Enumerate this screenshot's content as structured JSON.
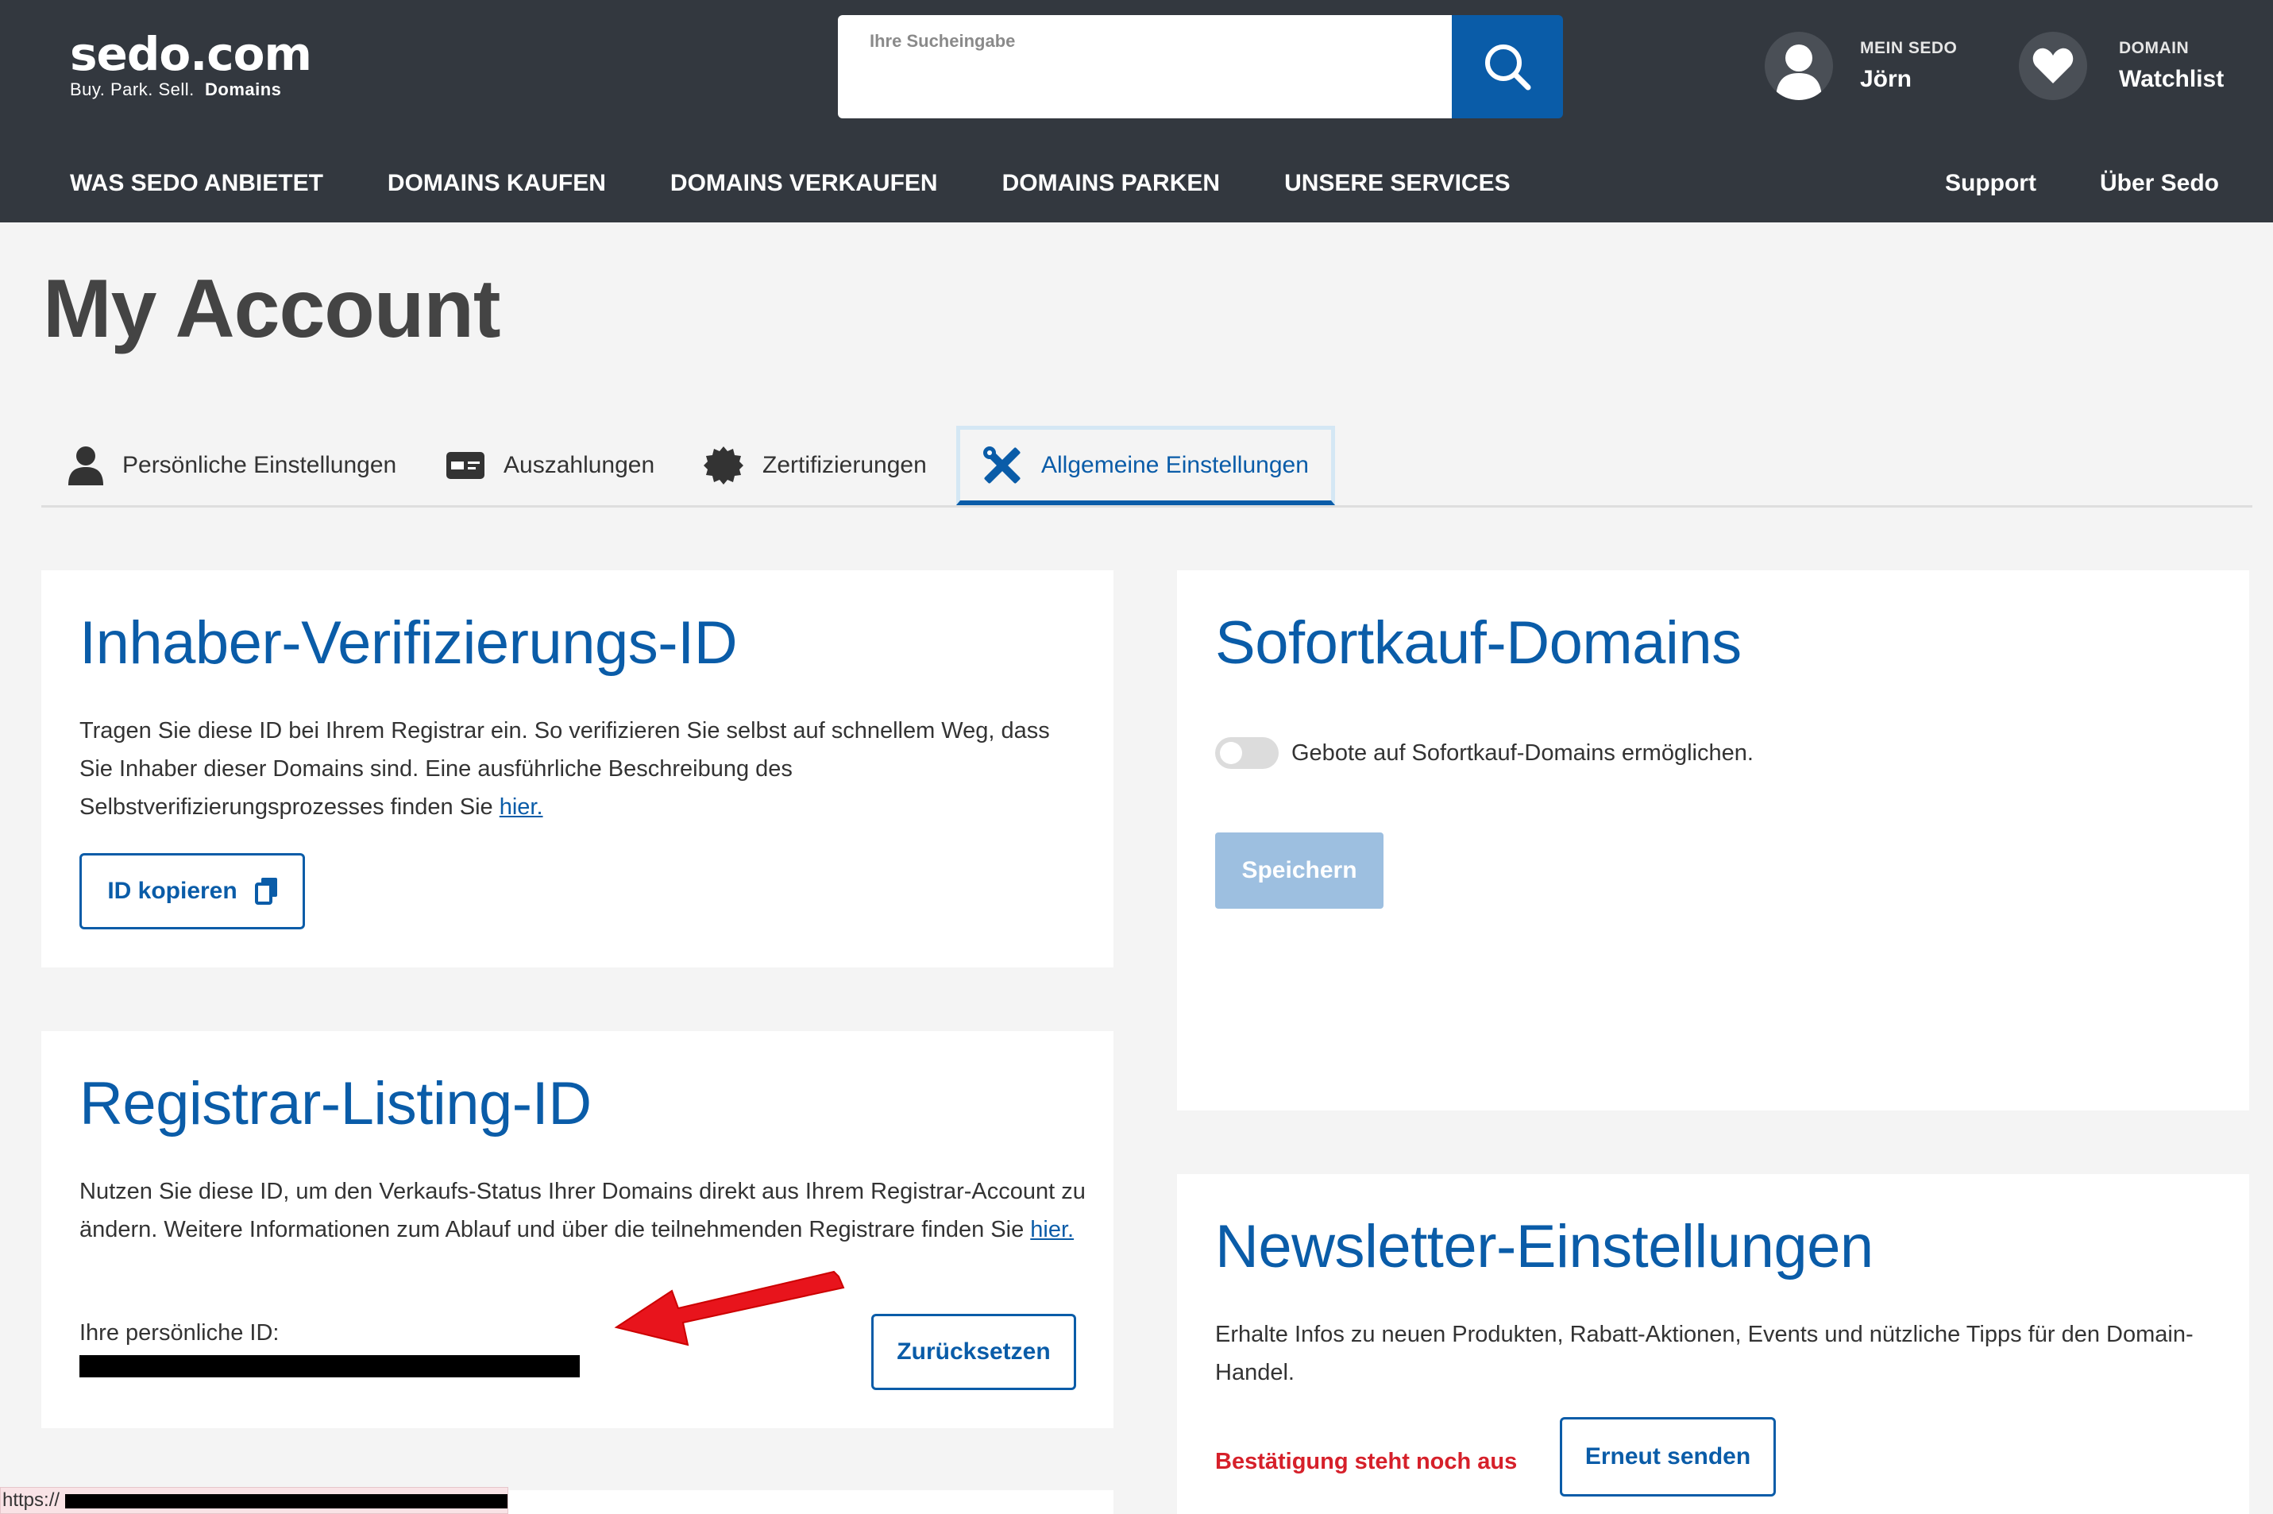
{
  "header": {
    "logo_main": "sedo.com",
    "logo_sub_plain": "Buy.  Park.  Sell.",
    "logo_sub_bold": "Domains",
    "search_placeholder": "Ihre Sucheingabe",
    "account": {
      "small": "MEIN SEDO",
      "big": "Jörn"
    },
    "watchlist": {
      "small": "DOMAIN",
      "big": "Watchlist"
    },
    "nav": [
      "WAS SEDO ANBIETET",
      "DOMAINS KAUFEN",
      "DOMAINS VERKAUFEN",
      "DOMAINS PARKEN",
      "UNSERE SERVICES"
    ],
    "nav_right": [
      "Support",
      "Über Sedo"
    ]
  },
  "page": {
    "title": "My Account"
  },
  "tabs": [
    {
      "label": "Persönliche Einstellungen",
      "icon": "user-icon"
    },
    {
      "label": "Auszahlungen",
      "icon": "payment-card-icon"
    },
    {
      "label": "Zertifizierungen",
      "icon": "certificate-badge-icon"
    },
    {
      "label": "Allgemeine Einstellungen",
      "icon": "settings-tools-icon",
      "active": true
    }
  ],
  "owner_verification": {
    "title": "Inhaber-Verifizierungs-ID",
    "text": "Tragen Sie diese ID bei Ihrem Registrar ein. So verifizieren Sie selbst auf schnellem Weg, dass Sie Inhaber dieser Domains sind. Eine ausführliche Beschreibung des Selbstverifizierungsprozesses finden Sie ",
    "link": "hier.",
    "button": "ID kopieren"
  },
  "registrar_listing": {
    "title": "Registrar-Listing-ID",
    "text": "Nutzen Sie diese ID, um den Verkaufs-Status Ihrer Domains direkt aus Ihrem Registrar-Account zu ändern. Weitere Informationen zum Ablauf und über die teilnehmenden Registrare finden Sie ",
    "link": "hier.",
    "id_label": "Ihre persönliche ID:",
    "button": "Zurücksetzen"
  },
  "instant_buy": {
    "title": "Sofortkauf-Domains",
    "toggle_label": "Gebote auf Sofortkauf-Domains ermöglichen.",
    "toggle_on": false,
    "button": "Speichern"
  },
  "newsletter": {
    "title": "Newsletter-Einstellungen",
    "text": "Erhalte Infos zu neuen Produkten, Rabatt-Aktionen, Events und nützliche Tipps für den Domain-Handel.",
    "status": "Bestätigung steht noch aus",
    "button": "Erneut senden"
  },
  "status_bar": {
    "url": "https://"
  },
  "colors": {
    "brand_blue": "#0a5ca8",
    "header_bg": "#33383f",
    "status_red": "#d6202a",
    "arrow_red": "#e8141c"
  }
}
